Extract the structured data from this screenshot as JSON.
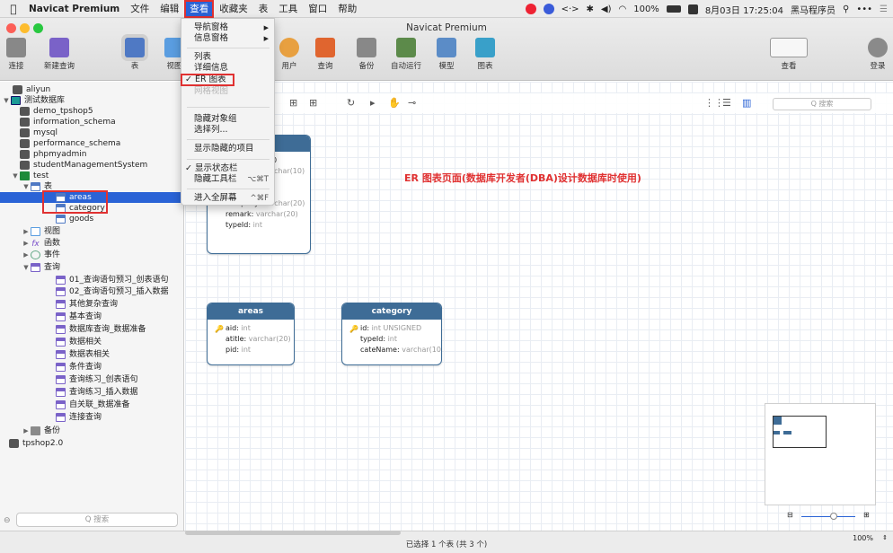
{
  "menubar": {
    "app_name": "Navicat Premium",
    "items": [
      "文件",
      "编辑",
      "查看",
      "收藏夹",
      "表",
      "工具",
      "窗口",
      "帮助"
    ],
    "battery": "100%",
    "datetime": "8月03日 17:25:04",
    "user": "黑马程序员"
  },
  "window": {
    "title": "Navicat Premium"
  },
  "toolbar": {
    "items": [
      "连接",
      "新建查询",
      "表",
      "视图",
      "用户",
      "查询",
      "备份",
      "自动运行",
      "模型",
      "图表"
    ],
    "view_label": "查看",
    "login_label": "登录"
  },
  "sidebar": {
    "connection": "aliyun",
    "connection2": "测试数据库",
    "databases": [
      "demo_tpshop5",
      "information_schema",
      "mysql",
      "performance_schema",
      "phpmyadmin",
      "studentManagementSystem"
    ],
    "test_db": "test",
    "tables_group": "表",
    "tables": [
      "areas",
      "category",
      "goods"
    ],
    "views_group": "视图",
    "functions_group": "函数",
    "events_group": "事件",
    "queries_group": "查询",
    "queries": [
      "01_查询语句预习_创表语句",
      "02_查询语句预习_插入数据",
      "其他复杂查询",
      "基本查询",
      "数据库查询_数据准备",
      "数据相关",
      "数据表相关",
      "条件查询",
      "查询练习_创表语句",
      "查询练习_插入数据",
      "自关联_数据准备",
      "连接查询"
    ],
    "backup_group": "备份",
    "last_db": "tpshop2.0",
    "search_placeholder": "Q 搜索"
  },
  "dropdown": {
    "nav_pane": "导航窗格",
    "info_pane": "信息窗格",
    "list": "列表",
    "detail": "详细信息",
    "er": "✓ ER 图表",
    "grid": "网格视图",
    "hide_group": "隐藏对象组",
    "choose_cols": "选择列...",
    "show_hidden": "显示隐藏的项目",
    "show_status": "✓ 显示状态栏",
    "hide_toolbar": "隐藏工具栏",
    "hide_toolbar_sc": "⌥⌘T",
    "fullscreen": "进入全屏幕",
    "fullscreen_sc": "^⌘F"
  },
  "er_search_placeholder": "Q 搜索",
  "annotation": "ER 图表页面(数据库开发者(DBA)设计数据库时使用)",
  "entities": {
    "goods": {
      "fields_visible": [
        {
          "name": "",
          "type": "char(10)"
        },
        {
          "name": "company",
          "type": "varchar(20)"
        },
        {
          "name": "remark",
          "type": "varchar(20)"
        },
        {
          "name": "typeId",
          "type": "int"
        }
      ],
      "partial_top": "0"
    },
    "areas": {
      "title": "areas",
      "fields": [
        {
          "name": "aid",
          "type": "int",
          "key": true
        },
        {
          "name": "atitle",
          "type": "varchar(20)",
          "key": false
        },
        {
          "name": "pid",
          "type": "int",
          "key": false
        }
      ]
    },
    "category": {
      "title": "category",
      "fields": [
        {
          "name": "id",
          "type": "int UNSIGNED",
          "key": true
        },
        {
          "name": "typeId",
          "type": "int",
          "key": false
        },
        {
          "name": "cateName",
          "type": "varchar(10)",
          "key": false
        }
      ]
    }
  },
  "status": "已选择 1 个表 (共 3 个)",
  "zoom": "100%",
  "colors": {
    "accent": "#2a63d6",
    "entity_header": "#3e6c96",
    "highlight": "#e03131"
  }
}
